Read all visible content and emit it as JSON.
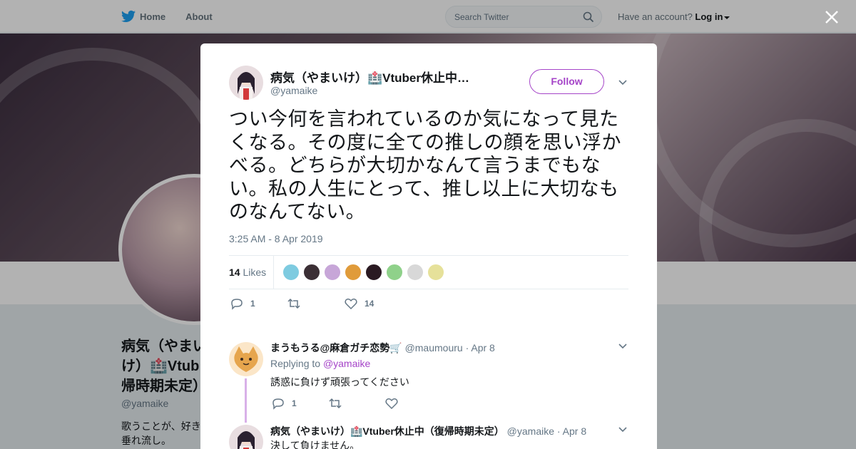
{
  "nav": {
    "home": "Home",
    "about": "About",
    "search_placeholder": "Search Twitter",
    "have_account": "Have an account?",
    "login": "Log in"
  },
  "profile": {
    "name_l1": "病気（やまい",
    "name_l2": "け）🏥Vtub",
    "name_l3": "帰時期未定）",
    "handle": "@yamaike",
    "bio_l1": "歌うことが、好き",
    "bio_l2": "垂れ流し。"
  },
  "tweet": {
    "author_name": "病気（やまいけ）🏥Vtuber休止中…",
    "author_handle": "@yamaike",
    "follow": "Follow",
    "text": "つい今何を言われているのか気になって見たくなる。その度に全ての推しの顔を思い浮かべる。どちらが大切かなんて言うまでもない。私の人生にとって、推し以上に大切なものなんてない。",
    "time": "3:25 AM - 8 Apr 2019",
    "likes_count": "14",
    "likes_label": "Likes",
    "reply_count": "1",
    "like_count": "14",
    "liker_colors": [
      "#7ecbe0",
      "#3b2f35",
      "#c7a6d8",
      "#e09b3a",
      "#2a1a22",
      "#8fd18a",
      "#d8d8d8",
      "#e6e19a"
    ]
  },
  "replies": [
    {
      "name": "まうもうる@麻倉ガチ恋勢🛒",
      "handle": "@maumouru",
      "date": "· Apr 8",
      "replying_to_label": "Replying to",
      "replying_to_handle": "@yamaike",
      "text": "誘惑に負けず頑張ってください",
      "reply_count": "1"
    },
    {
      "name": "病気（やまいけ）🏥Vtuber休止中（復帰時期未定）",
      "handle": "@yamaike",
      "date": "· Apr 8",
      "text": "決して負けません。"
    }
  ],
  "colors": {
    "accent": "#a544c8",
    "twitter_blue": "#1da1f2"
  }
}
